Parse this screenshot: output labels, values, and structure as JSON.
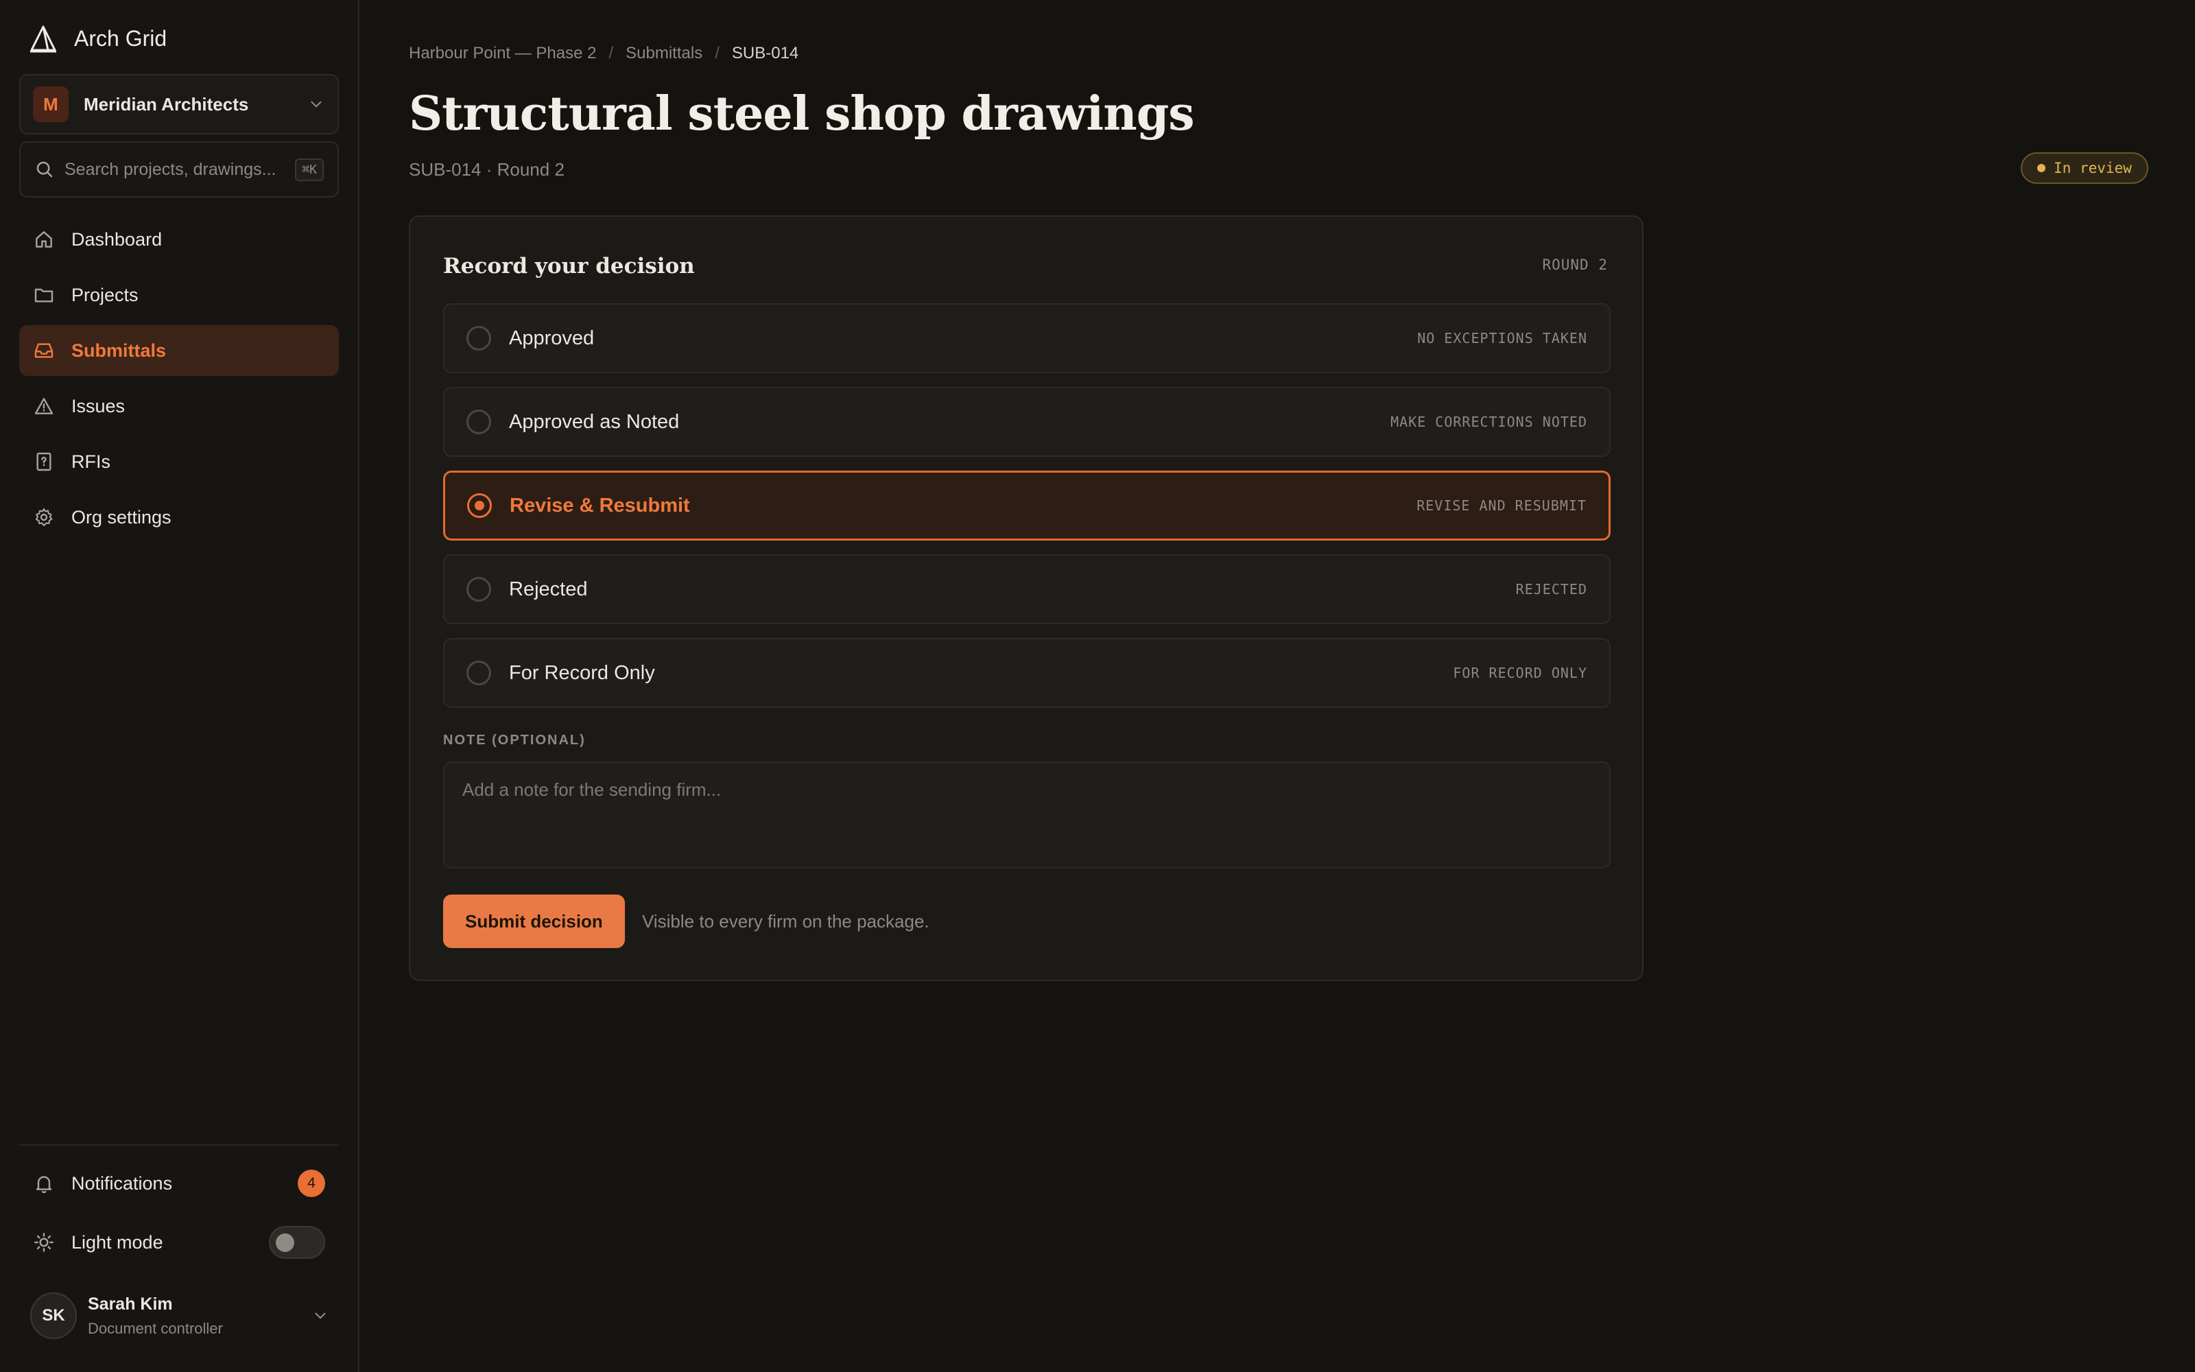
{
  "app": {
    "name": "Arch Grid"
  },
  "org": {
    "initial": "M",
    "name": "Meridian Architects"
  },
  "search": {
    "placeholder": "Search projects, drawings...",
    "shortcut": "⌘K"
  },
  "nav": [
    {
      "label": "Dashboard",
      "icon": "home-icon"
    },
    {
      "label": "Projects",
      "icon": "folder-icon"
    },
    {
      "label": "Submittals",
      "icon": "inbox-icon",
      "active": true
    },
    {
      "label": "Issues",
      "icon": "warning-icon"
    },
    {
      "label": "RFIs",
      "icon": "help-square-icon"
    },
    {
      "label": "Org settings",
      "icon": "gear-icon"
    }
  ],
  "notifications": {
    "label": "Notifications",
    "count": "4"
  },
  "theme": {
    "label": "Light mode",
    "enabled": false
  },
  "user": {
    "initials": "SK",
    "name": "Sarah Kim",
    "role": "Document controller"
  },
  "breadcrumb": {
    "project": "Harbour Point — Phase 2",
    "section": "Submittals",
    "current": "SUB-014"
  },
  "page": {
    "title": "Structural steel shop drawings",
    "subtitle": "SUB-014 · Round 2",
    "status": "In review"
  },
  "decision": {
    "title": "Record your decision",
    "round": "ROUND 2",
    "options": [
      {
        "label": "Approved",
        "code": "NO EXCEPTIONS TAKEN",
        "selected": false
      },
      {
        "label": "Approved as Noted",
        "code": "MAKE CORRECTIONS NOTED",
        "selected": false
      },
      {
        "label": "Revise & Resubmit",
        "code": "REVISE AND RESUBMIT",
        "selected": true
      },
      {
        "label": "Rejected",
        "code": "REJECTED",
        "selected": false
      },
      {
        "label": "For Record Only",
        "code": "FOR RECORD ONLY",
        "selected": false
      }
    ],
    "note_label": "NOTE (OPTIONAL)",
    "note_placeholder": "Add a note for the sending firm...",
    "submit_label": "Submit decision",
    "submit_hint": "Visible to every firm on the package."
  },
  "colors": {
    "accent": "#ea6f35",
    "background": "#141310",
    "status_review": "#e6b452"
  }
}
